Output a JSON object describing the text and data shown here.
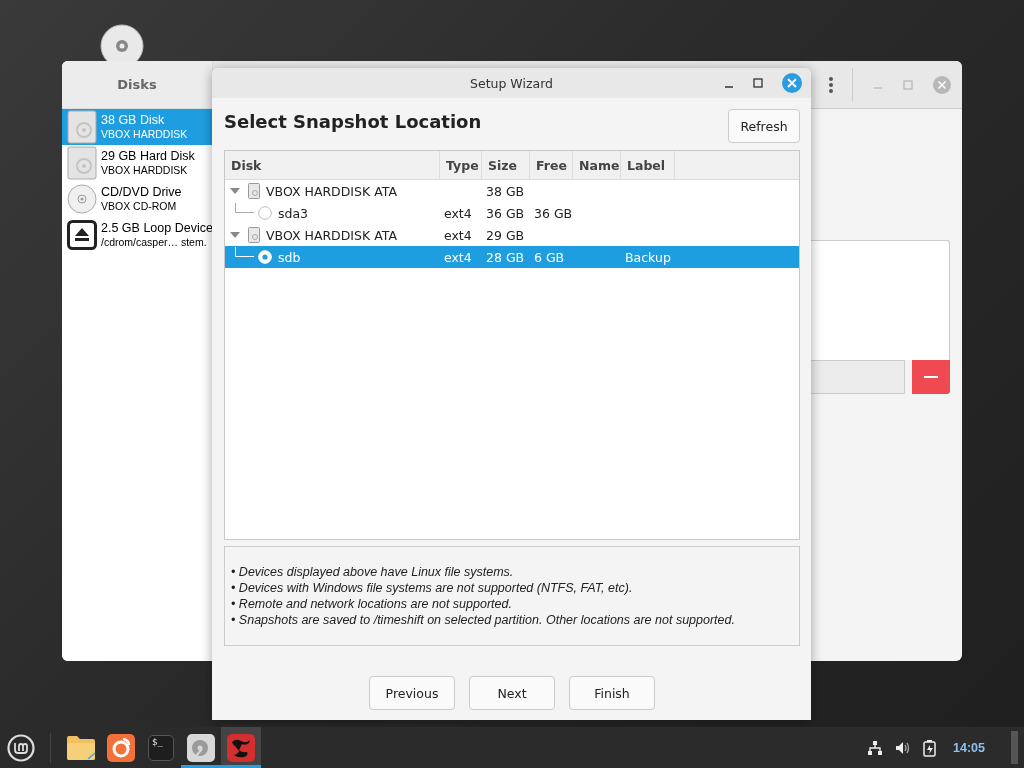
{
  "disks_window": {
    "title": "Disks",
    "devices": [
      {
        "kind": "hdd",
        "name": "38 GB Disk",
        "detail": "VBOX HARDDISK",
        "selected": true
      },
      {
        "kind": "hdd",
        "name": "29 GB Hard Disk",
        "detail": "VBOX HARDDISK",
        "selected": false
      },
      {
        "kind": "optical",
        "name": "CD/DVD Drive",
        "detail": "VBOX CD-ROM",
        "selected": false
      },
      {
        "kind": "loop",
        "name": "2.5 GB Loop Device",
        "detail": "/cdrom/casper… stem.",
        "selected": false
      }
    ]
  },
  "wizard": {
    "title": "Setup Wizard",
    "heading": "Select Snapshot Location",
    "refresh": "Refresh",
    "columns": [
      "Disk",
      "Type",
      "Size",
      "Free",
      "Name",
      "Label"
    ],
    "tree": [
      {
        "disk": "VBOX HARDDISK ATA",
        "size": "38 GB",
        "expanded": true,
        "children": [
          {
            "disk": "sda3",
            "type": "ext4",
            "size": "36 GB",
            "free": "36 GB",
            "selected": false
          }
        ]
      },
      {
        "disk": "VBOX HARDDISK ATA",
        "type": "ext4",
        "size": "29 GB",
        "expanded": true,
        "children": [
          {
            "disk": "sdb",
            "type": "ext4",
            "size": "28 GB",
            "free": "6 GB",
            "label": "Backup",
            "selected": true
          }
        ]
      }
    ],
    "notes": [
      "• Devices displayed above have Linux file systems.",
      "• Devices with Windows file systems are not supported (NTFS, FAT, etc).",
      "• Remote and network locations are not supported.",
      "• Snapshots are saved to /timeshift on selected partition. Other locations are not supported."
    ],
    "buttons": [
      "Previous",
      "Next",
      "Finish"
    ]
  },
  "taskbar": {
    "apps": [
      {
        "kind": "folder",
        "running": false,
        "active": false
      },
      {
        "kind": "browser",
        "running": false,
        "active": false
      },
      {
        "kind": "terminal",
        "glyph": "$_",
        "running": false,
        "active": false
      },
      {
        "kind": "disks",
        "running": true,
        "active": false
      },
      {
        "kind": "timeshift",
        "running": true,
        "active": true
      }
    ],
    "clock": "14:05"
  }
}
